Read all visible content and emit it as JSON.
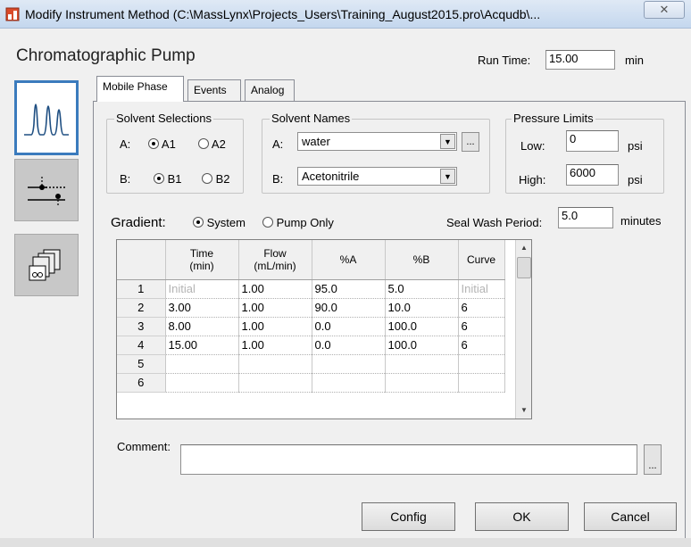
{
  "window": {
    "title": "Modify Instrument Method (C:\\MassLynx\\Projects_Users\\Training_August2015.pro\\Acqudb\\...",
    "close_label": "⌫"
  },
  "header": {
    "heading": "Chromatographic Pump",
    "run_time_label": "Run Time:",
    "run_time_value": "15.00",
    "run_time_unit": "min"
  },
  "sidebar": {
    "items": [
      {
        "name": "chromatogram-icon",
        "selected": true
      },
      {
        "name": "valve-icon",
        "selected": false
      },
      {
        "name": "solvent-bottles-icon",
        "selected": false
      }
    ]
  },
  "tabs": [
    {
      "label": "Mobile Phase",
      "active": true
    },
    {
      "label": "Events",
      "active": false
    },
    {
      "label": "Analog",
      "active": false
    }
  ],
  "solvent_selections": {
    "legend": "Solvent Selections",
    "row_a_label": "A:",
    "row_b_label": "B:",
    "a1": "A1",
    "a2": "A2",
    "b1": "B1",
    "b2": "B2",
    "a_selected": "A1",
    "b_selected": "B1"
  },
  "solvent_names": {
    "legend": "Solvent Names",
    "a_label": "A:",
    "a_value": "water",
    "b_label": "B:",
    "b_value": "Acetonitrile",
    "browse_label": "..."
  },
  "pressure_limits": {
    "legend": "Pressure Limits",
    "low_label": "Low:",
    "low_value": "0",
    "high_label": "High:",
    "high_value": "6000",
    "unit": "psi"
  },
  "gradient": {
    "label": "Gradient:",
    "system_label": "System",
    "pump_only_label": "Pump Only",
    "selected": "System",
    "seal_wash_label": "Seal Wash Period:",
    "seal_wash_value": "5.0",
    "seal_wash_unit": "minutes"
  },
  "table": {
    "headers": [
      "",
      "Time\n(min)",
      "Flow\n(mL/min)",
      "%A",
      "%B",
      "Curve"
    ],
    "rows": [
      [
        "1",
        "Initial",
        "1.00",
        "95.0",
        "5.0",
        "Initial"
      ],
      [
        "2",
        "3.00",
        "1.00",
        "90.0",
        "10.0",
        "6"
      ],
      [
        "3",
        "8.00",
        "1.00",
        "0.0",
        "100.0",
        "6"
      ],
      [
        "4",
        "15.00",
        "1.00",
        "0.0",
        "100.0",
        "6"
      ],
      [
        "5",
        "",
        "",
        "",
        "",
        ""
      ],
      [
        "6",
        "",
        "",
        "",
        "",
        ""
      ]
    ]
  },
  "comment": {
    "label": "Comment:",
    "value": "",
    "browse_label": "..."
  },
  "buttons": {
    "config": "Config",
    "ok": "OK",
    "cancel": "Cancel"
  }
}
